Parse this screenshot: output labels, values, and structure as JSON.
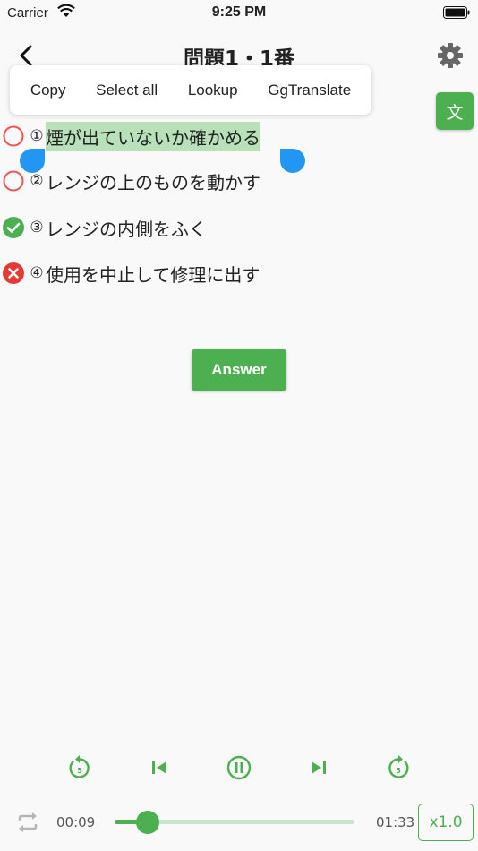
{
  "status_bar": {
    "carrier": "Carrier",
    "time": "9:25 PM"
  },
  "header": {
    "title": "問題1・1番"
  },
  "context_menu": {
    "items": [
      {
        "label": "Copy"
      },
      {
        "label": "Select all"
      },
      {
        "label": "Lookup"
      },
      {
        "label": "GgTranslate"
      }
    ]
  },
  "translate_button": {
    "label": "文"
  },
  "options": [
    {
      "number": "①",
      "text": "煙が出ていないか確かめる",
      "state": "unanswered",
      "selected": true
    },
    {
      "number": "②",
      "text": "レンジの上のものを動かす",
      "state": "unanswered",
      "selected": false
    },
    {
      "number": "③",
      "text": "レンジの内側をふく",
      "state": "correct",
      "selected": false
    },
    {
      "number": "④",
      "text": "使用を中止して修理に出す",
      "state": "wrong",
      "selected": false
    }
  ],
  "answer_button": {
    "label": "Answer"
  },
  "player": {
    "current_time": "00:09",
    "total_time": "01:33",
    "progress": 0.097,
    "speed": "x1.0",
    "rewind_seconds": "5",
    "forward_seconds": "5"
  },
  "colors": {
    "accent": "#4caf50",
    "selection": "#b8e0b9",
    "handle": "#2196f3",
    "wrong": "#e53935",
    "ring": "#ef5350"
  }
}
